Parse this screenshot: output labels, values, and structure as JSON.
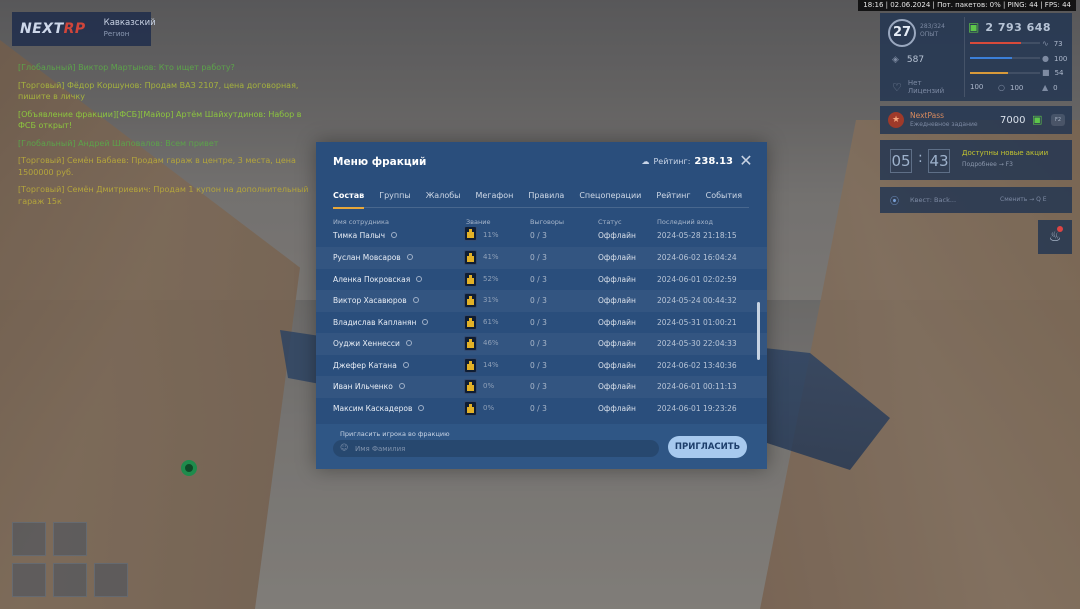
{
  "logo": {
    "brand": "NEXT",
    "brand_suffix": "RP",
    "server_name": "Кавказский",
    "server_sub": "Регион"
  },
  "status_bar": "18:16 | 02.06.2024 | Пот. пакетов: 0% | PING: 44 | FPS: 44",
  "chat": [
    {
      "text": "[Глобальный] Виктор Мартынов: Кто ищет работу?",
      "color": "green"
    },
    {
      "text": "[Торговый] Фёдор Коршунов: Продам ВАЗ 2107, цена договорная, пишите в личку",
      "color": "olive"
    },
    {
      "text": "[Объявление фракции][ФСБ][Майор] Артём Шайхутдинов: Набор в ФСБ открыт!",
      "color": "lime"
    },
    {
      "text": "[Глобальный] Андрей Шаповалов: Всем привет",
      "color": "green"
    },
    {
      "text": "[Торговый] Семён Бабаев: Продам гараж в центре, 3 места, цена 1500000 руб.",
      "color": "gold"
    },
    {
      "text": "[Торговый] Семён Дмитриевич: Продам 1 купон на дополнительный гараж 15к",
      "color": "gold"
    }
  ],
  "hud": {
    "level": "27",
    "exp_line1": "283/324",
    "exp_line2": "ОПЫТ",
    "money": "2 793 648",
    "coins": "587",
    "rep_label": "Нет",
    "rep_sub": "Лицензий",
    "stats": {
      "health": "73",
      "mic": "100",
      "food": "54",
      "armor": "100",
      "drink": "100",
      "wanted": "0"
    },
    "bars": {
      "health": 0.73,
      "armor": 0.6,
      "food": 0.54
    },
    "colors": {
      "health": "#d84a3a",
      "armor": "#3b7fd8",
      "food": "#d89a3a"
    }
  },
  "pass_panel": {
    "title": "NextPass",
    "subtitle": "Ежедневное задание",
    "amount": "7000",
    "btn": "F2"
  },
  "timer_panel": {
    "d1": "05",
    "d2": "43",
    "title": "Доступны новые акции",
    "subtitle": "Подробнее → F3"
  },
  "quest_panel": {
    "text": "Квест: Back...",
    "sub": "Сменить → Q  E"
  },
  "menu": {
    "title": "Меню фракций",
    "rating_label": "Рейтинг:",
    "rating_value": "238.13",
    "tabs": [
      "Состав",
      "Группы",
      "Жалобы",
      "Мегафон",
      "Правила",
      "Спецоперации",
      "Рейтинг",
      "События"
    ],
    "columns": [
      "Имя сотрудника",
      "Звание",
      "Выговоры",
      "Статус",
      "Последний вход"
    ],
    "rows": [
      {
        "name": "Тимка Палыч",
        "percent": "11%",
        "warnings": "0 / 3",
        "status": "Оффлайн",
        "last_login": "2024-05-28 21:18:15"
      },
      {
        "name": "Руслан Мовсаров",
        "percent": "41%",
        "warnings": "0 / 3",
        "status": "Оффлайн",
        "last_login": "2024-06-02 16:04:24"
      },
      {
        "name": "Аленка Покровская",
        "percent": "52%",
        "warnings": "0 / 3",
        "status": "Оффлайн",
        "last_login": "2024-06-01 02:02:59"
      },
      {
        "name": "Виктор Хасавюров",
        "percent": "31%",
        "warnings": "0 / 3",
        "status": "Оффлайн",
        "last_login": "2024-05-24 00:44:32"
      },
      {
        "name": "Владислав Капланян",
        "percent": "61%",
        "warnings": "0 / 3",
        "status": "Оффлайн",
        "last_login": "2024-05-31 01:00:21"
      },
      {
        "name": "Оуджи Хеннесси",
        "percent": "46%",
        "warnings": "0 / 3",
        "status": "Оффлайн",
        "last_login": "2024-05-30 22:04:33"
      },
      {
        "name": "Джефер Катана",
        "percent": "14%",
        "warnings": "0 / 3",
        "status": "Оффлайн",
        "last_login": "2024-06-02 13:40:36"
      },
      {
        "name": "Иван Ильченко",
        "percent": "0%",
        "warnings": "0 / 3",
        "status": "Оффлайн",
        "last_login": "2024-06-01 00:11:13"
      },
      {
        "name": "Максим Каскадеров",
        "percent": "0%",
        "warnings": "0 / 3",
        "status": "Оффлайн",
        "last_login": "2024-06-01 19:23:26"
      }
    ],
    "invite_label": "Пригласить игрока во фракцию",
    "invite_placeholder": "Имя Фамилия",
    "invite_button": "ПРИГЛАСИТЬ"
  }
}
